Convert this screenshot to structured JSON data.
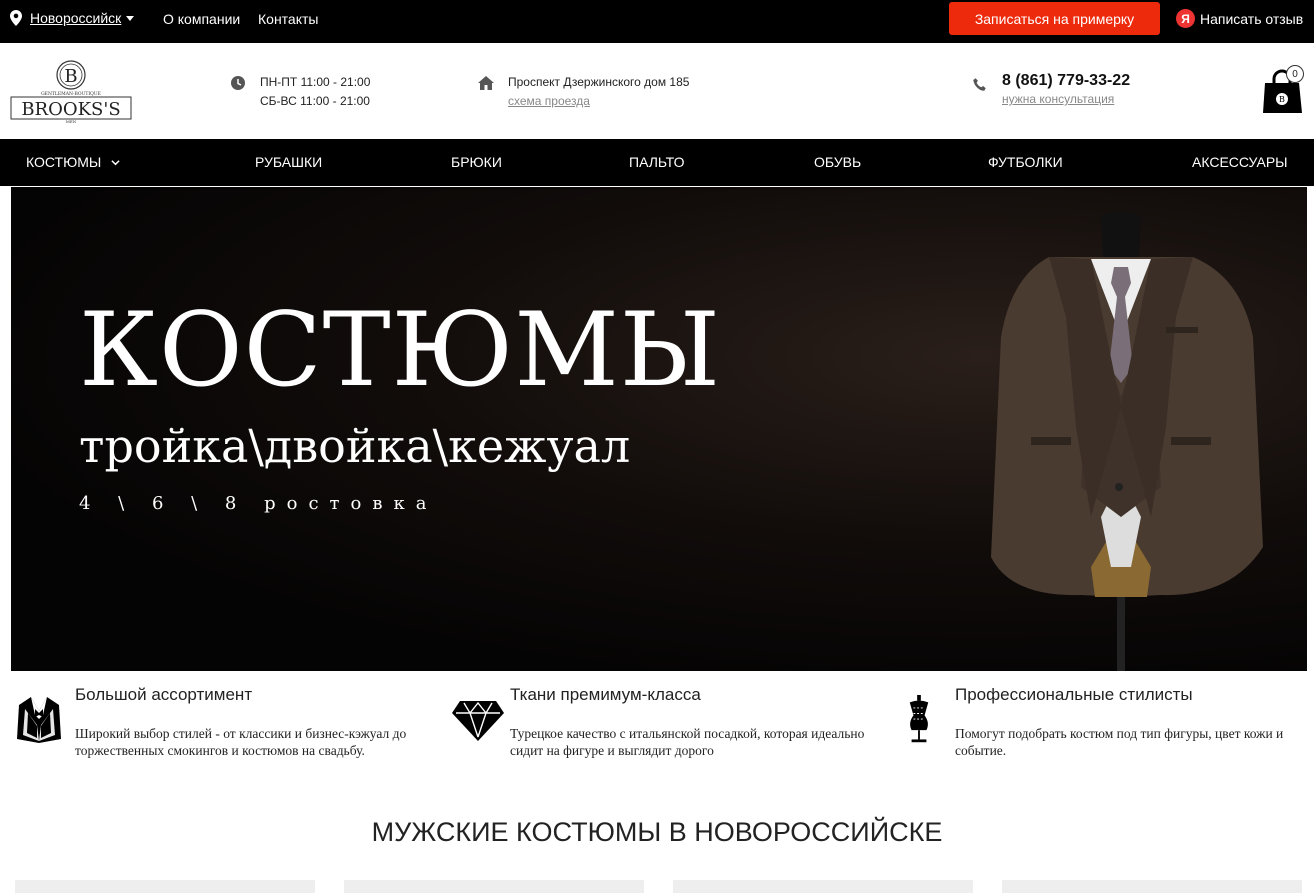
{
  "topbar": {
    "city": "Новороссийск",
    "links": [
      "О компании",
      "Контакты"
    ],
    "fitting_button": "Записаться на примерку",
    "review_badge": "Я",
    "review_link": "Написать отзыв"
  },
  "header": {
    "logo": {
      "letter": "B",
      "name": "BROOKS'S",
      "tagline": "GENTLEMAN-BOUTIQUE",
      "sub": "MEN"
    },
    "hours": [
      "ПН-ПТ 11:00 - 21:00",
      "СБ-ВС 11:00 - 21:00"
    ],
    "address": "Проспект Дзержинского дом 185",
    "directions": "схема проезда",
    "phone": "8 (861) 779-33-22",
    "consult": "нужна консультация",
    "cart_count": "0"
  },
  "nav": [
    "КОСТЮМЫ",
    "РУБАШКИ",
    "БРЮКИ",
    "ПАЛЬТО",
    "ОБУВЬ",
    "ФУТБОЛКИ",
    "АКСЕССУАРЫ"
  ],
  "hero": {
    "title": "КОСТЮМЫ",
    "subtitle": "тройка\\двойка\\кежуал",
    "sizes": "4 \\ 6 \\ 8 ростовка"
  },
  "features": [
    {
      "icon": "tuxedo-icon",
      "title": "Большой ассортимент",
      "text": "Широкий выбор стилей - от классики и бизнес-кэжуал до торжественных смокингов и костюмов на свадьбу."
    },
    {
      "icon": "diamond-icon",
      "title": "Ткани премимум-класса",
      "text": "Турецкое качество с итальянской посадкой, которая идеально сидит на фигуре и выглядит дорого"
    },
    {
      "icon": "mannequin-icon",
      "title": "Профессиональные стилисты",
      "text": "Помогут подобрать костюм под тип фигуры, цвет кожи и событие."
    }
  ],
  "section_title": "МУЖСКИЕ КОСТЮМЫ В НОВОРОССИЙСКЕ",
  "colors": {
    "accent": "#ee2a0c",
    "dark": "#000000"
  }
}
